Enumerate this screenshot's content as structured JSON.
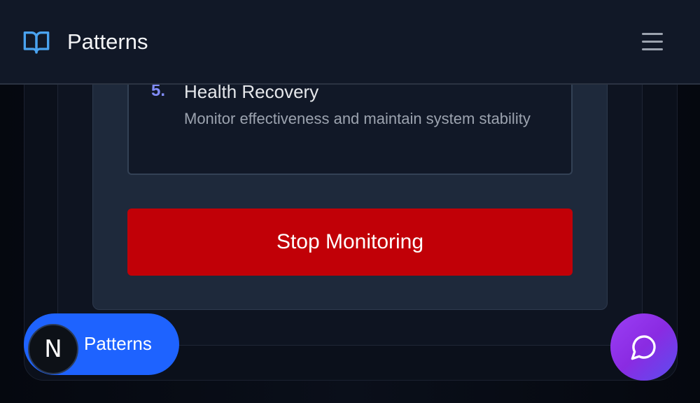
{
  "header": {
    "title": "Patterns",
    "icon": "book-open-icon",
    "menu_icon": "hamburger-menu-icon"
  },
  "steps": [
    {
      "number": "5.",
      "title": "Health Recovery",
      "description": "Monitor effectiveness and maintain system stability"
    }
  ],
  "actions": {
    "stop_label": "Stop Monitoring"
  },
  "floating_pill": {
    "avatar_letter": "N",
    "label": "Patterns"
  },
  "chat": {
    "icon": "chat-bubble-icon"
  },
  "colors": {
    "accent": "#818cf8",
    "danger": "#c10007",
    "pill": "#1e63ff",
    "chat_gradient_start": "#9b3ff5",
    "chat_gradient_end": "#5b4ef0"
  }
}
